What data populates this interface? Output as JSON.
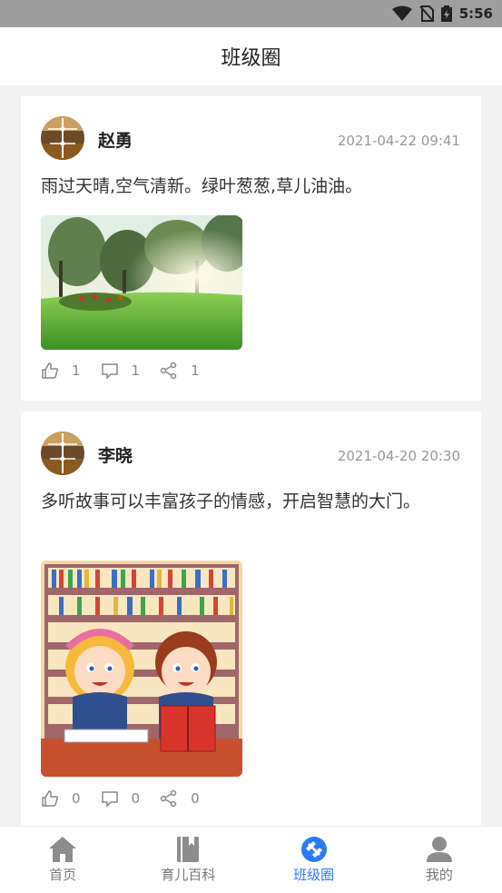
{
  "status_bar": {
    "time": "5:56"
  },
  "header": {
    "title": "班级圈"
  },
  "posts": [
    {
      "author": "赵勇",
      "time": "2021-04-22 09:41",
      "content": "雨过天晴,空气清新。绿叶葱葱,草儿油油。",
      "likes": "1",
      "comments": "1",
      "shares": "1"
    },
    {
      "author": "李晓",
      "time": "2021-04-20 20:30",
      "content": "多听故事可以丰富孩子的情感，开启智慧的大门。",
      "likes": "0",
      "comments": "0",
      "shares": "0"
    }
  ],
  "tabbar": {
    "items": [
      {
        "label": "首页",
        "icon": "home-icon"
      },
      {
        "label": "育儿百科",
        "icon": "book-icon"
      },
      {
        "label": "班级圈",
        "icon": "class-circle-icon",
        "active": true
      },
      {
        "label": "我的",
        "icon": "user-icon"
      }
    ]
  },
  "colors": {
    "accent": "#2b7bf5",
    "status_bar": "#9e9e9e"
  }
}
